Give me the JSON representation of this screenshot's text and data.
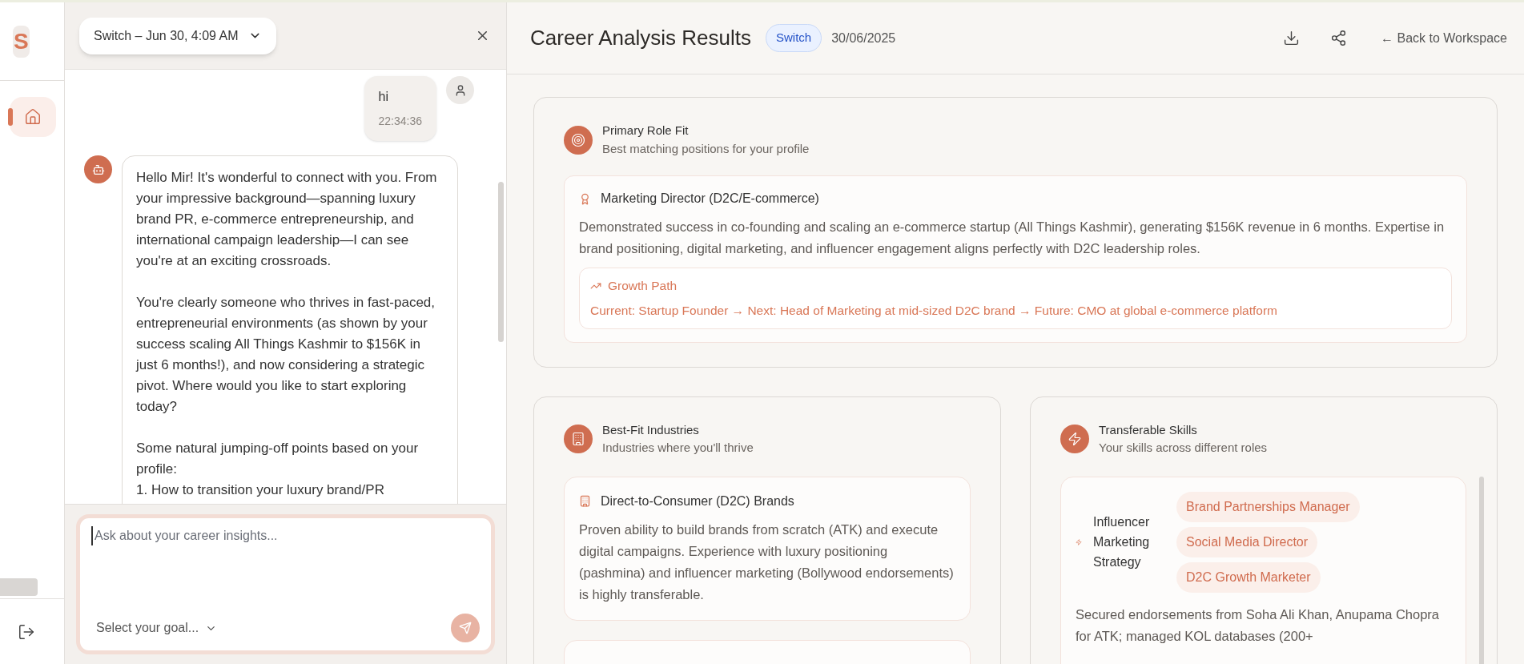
{
  "sidebar": {
    "logo": "S",
    "items": [
      {
        "kind": "home",
        "selected": true
      }
    ]
  },
  "chat": {
    "session": "Switch – Jun 30, 4:09 AM",
    "messages": [
      {
        "kind": "user",
        "text": "hi",
        "time": "22:34:36"
      },
      {
        "kind": "bot",
        "paragraphs": [
          "Hello Mir! It's wonderful to connect with you. From your impressive background—spanning luxury brand PR, e-commerce entrepreneurship, and international campaign leadership—I can see you're at an exciting crossroads.",
          "You're clearly someone who thrives in fast-paced, entrepreneurial environments (as shown by your success scaling All Things Kashmir to $156K in just 6 months!), and now considering a strategic pivot. Where would you like to start exploring today?",
          "Some natural jumping-off points based on your profile:\n1. How to transition your luxury brand/PR"
        ]
      }
    ],
    "input": {
      "placeholder": "Ask about your career insights...",
      "goal": "Select your goal..."
    }
  },
  "header": {
    "title": "Career Analysis Results",
    "badge": "Switch",
    "date": "30/06/2025",
    "back": "← Back to Workspace"
  },
  "primary": {
    "title": "Primary Role Fit",
    "subtitle": "Best matching positions for your profile",
    "role": {
      "title": "Marketing Director (D2C/E-commerce)",
      "description": "Demonstrated success in co-founding and scaling an e-commerce startup (All Things Kashmir), generating $156K revenue in 6 months. Expertise in brand positioning, digital marketing, and influencer engagement aligns perfectly with D2C leadership roles.",
      "growth_title": "Growth Path",
      "growth": "Current: Startup Founder → Next: Head of Marketing at mid-sized D2C brand → Future: CMO at global e-commerce platform"
    }
  },
  "industries": {
    "title": "Best-Fit Industries",
    "subtitle": "Industries where you'll thrive",
    "items": [
      {
        "title": "Direct-to-Consumer (D2C) Brands",
        "description": "Proven ability to build brands from scratch (ATK) and execute digital campaigns. Experience with luxury positioning (pashmina) and influencer marketing (Bollywood endorsements) is highly transferable."
      }
    ]
  },
  "skills": {
    "title": "Transferable Skills",
    "subtitle": "Your skills across different roles",
    "items": [
      {
        "skill": "Influencer Marketing Strategy",
        "roles": [
          "Brand Partnerships Manager",
          "Social Media Director",
          "D2C Growth Marketer"
        ],
        "description": "Secured endorsements from Soha Ali Khan, Anupama Chopra for ATK; managed KOL databases (200+"
      }
    ]
  }
}
